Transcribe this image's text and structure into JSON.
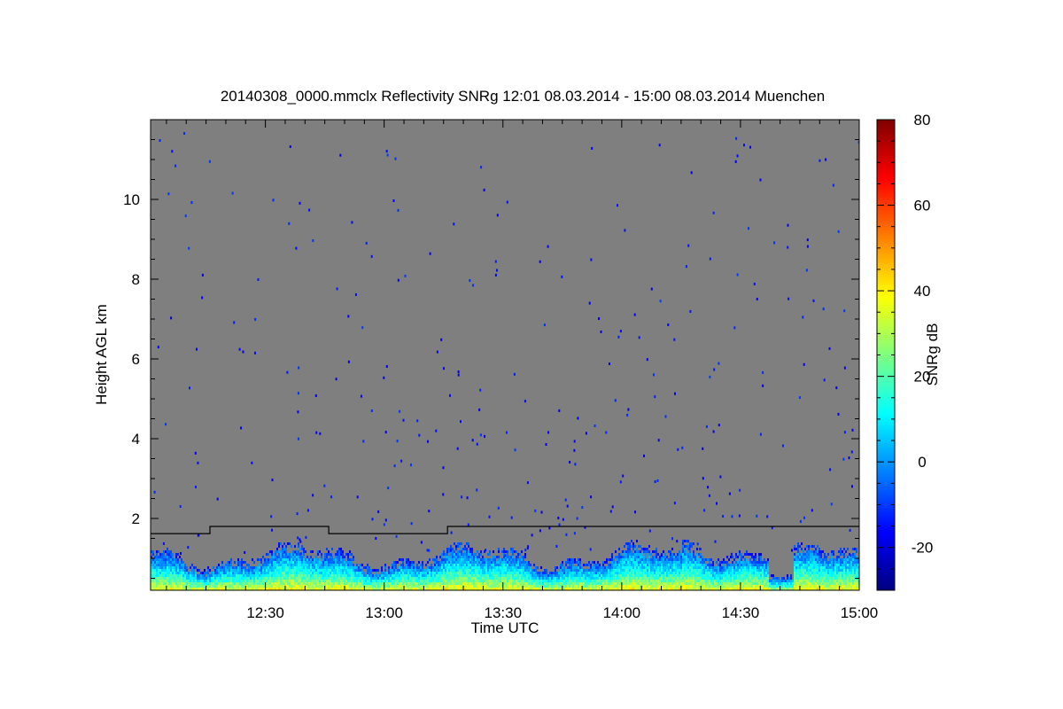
{
  "chart_data": {
    "type": "heatmap",
    "title": "20140308_0000.mmclx Reflectivity SNRg   12:01 08.03.2014 - 15:00 08.03.2014 Muenchen",
    "xlabel": "Time UTC",
    "ylabel": "Height AGL km",
    "x_range": [
      "12:01",
      "15:00"
    ],
    "x_tick_labels": [
      "12:30",
      "13:00",
      "13:30",
      "14:00",
      "14:30",
      "15:00"
    ],
    "y_range": [
      0.2,
      12.0
    ],
    "y_tick_values": [
      2,
      4,
      6,
      8,
      10
    ],
    "y_tick_labels": [
      "2",
      "4",
      "6",
      "8",
      "10"
    ],
    "background_color": "#7f7f7f",
    "colorbar": {
      "label": "SNRg dB",
      "range": [
        -30,
        80
      ],
      "tick_values": [
        -20,
        0,
        20,
        40,
        60,
        80
      ],
      "tick_labels": [
        "-20",
        "0",
        "20",
        "40",
        "60",
        "80"
      ],
      "colormap": "jet"
    },
    "echo_layer": {
      "description_units": "km",
      "top_km_approx": 1.1,
      "surface_max_dB": 45,
      "gap_near": "14:40"
    },
    "boundary_line": {
      "times": [
        "12:01",
        "12:16",
        "12:16",
        "12:46",
        "12:46",
        "13:16",
        "13:16",
        "15:00"
      ],
      "heights_km": [
        1.62,
        1.62,
        1.8,
        1.8,
        1.62,
        1.62,
        1.8,
        1.8
      ]
    }
  }
}
